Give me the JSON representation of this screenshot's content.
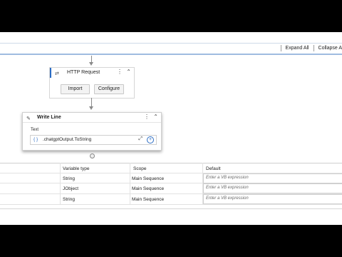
{
  "toolbar": {
    "expand_all": "Expand All",
    "collapse_all": "Collapse A"
  },
  "http_activity": {
    "title": "HTTP Request",
    "import_label": "Import",
    "configure_label": "Configure"
  },
  "write_line": {
    "title": "Write Line",
    "text_label": "Text",
    "brace": "{ }",
    "expression": ".chatgptOutput.ToString"
  },
  "variables": {
    "headers": [
      "Variable type",
      "Scope",
      "Default"
    ],
    "rows": [
      {
        "type": "String",
        "scope": "Main Sequence",
        "default_placeholder": "Enter a VB expression"
      },
      {
        "type": "JObject",
        "scope": "Main Sequence",
        "default_placeholder": "Enter a VB expression"
      },
      {
        "type": "String",
        "scope": "Main Sequence",
        "default_placeholder": "Enter a VB expression"
      }
    ]
  },
  "colors": {
    "accent": "#2b6cc4",
    "toolbar_border": "#9fbce0"
  }
}
